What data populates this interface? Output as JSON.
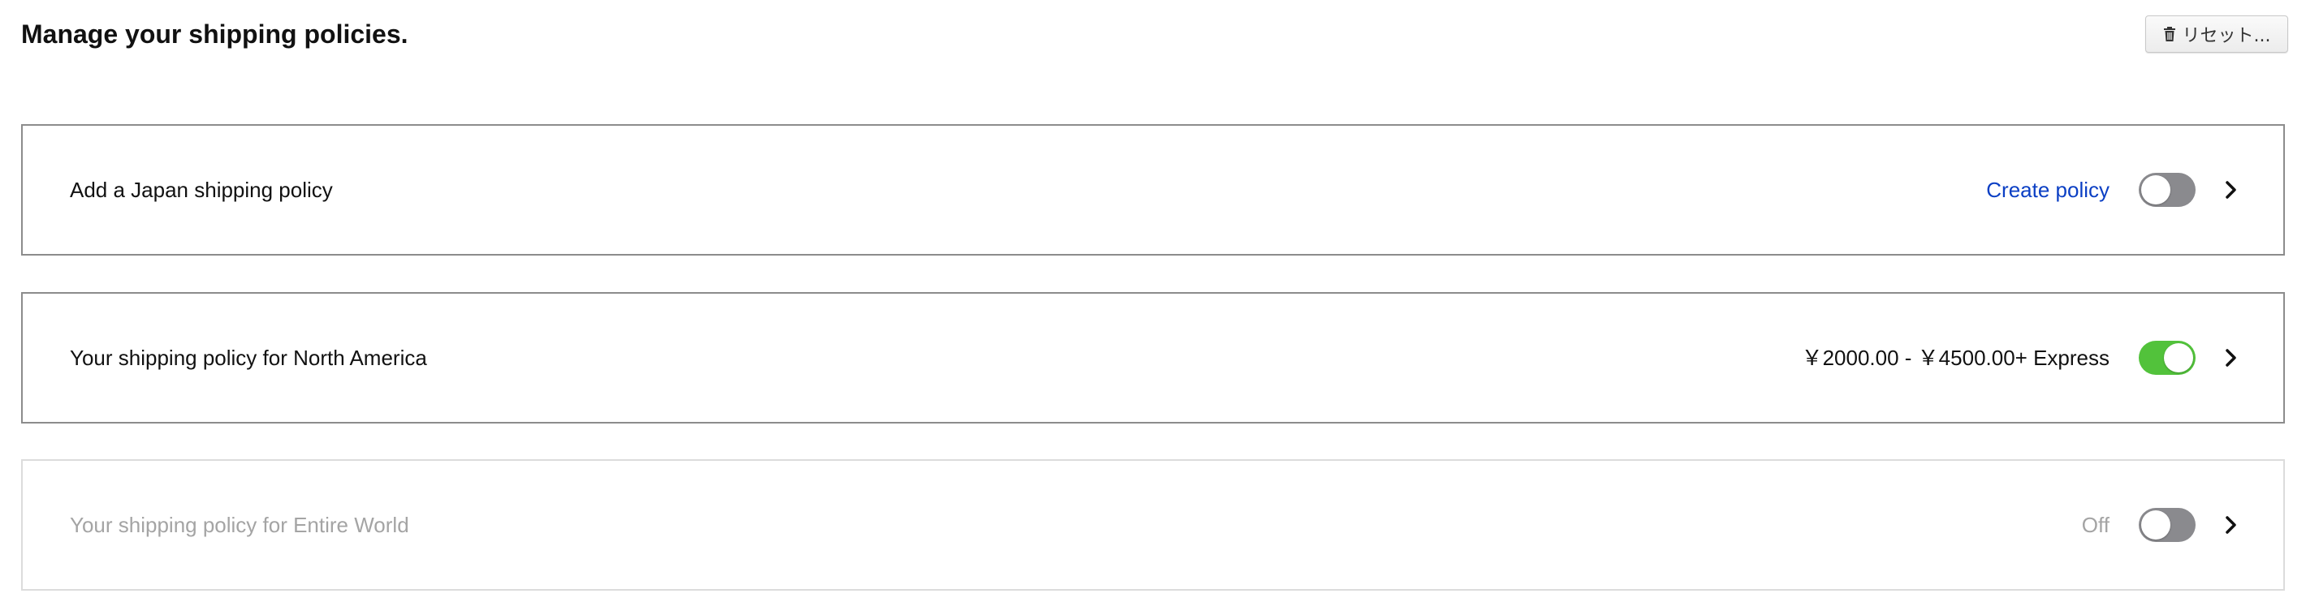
{
  "header": {
    "title": "Manage your shipping policies.",
    "reset_label": "リセット...",
    "reset_icon": "trash-icon"
  },
  "policies": [
    {
      "label": "Add a Japan shipping policy",
      "status": "Create policy",
      "status_is_link": true,
      "enabled": false,
      "toggle_on": false,
      "chevron_icon": "chevron-right-icon"
    },
    {
      "label": "Your shipping policy for North America",
      "status": "￥2000.00 - ￥4500.00+ Express",
      "status_is_link": false,
      "enabled": true,
      "toggle_on": true,
      "chevron_icon": "chevron-right-icon"
    },
    {
      "label": "Your shipping policy for Entire World",
      "status": "Off",
      "status_is_link": false,
      "enabled": false,
      "toggle_on": false,
      "chevron_icon": "chevron-right-icon"
    }
  ],
  "colors": {
    "link": "#0b3fc4",
    "toggle_on": "#52c23b",
    "toggle_off": "#8a8a8e",
    "disabled_text": "#a4a4a4"
  }
}
